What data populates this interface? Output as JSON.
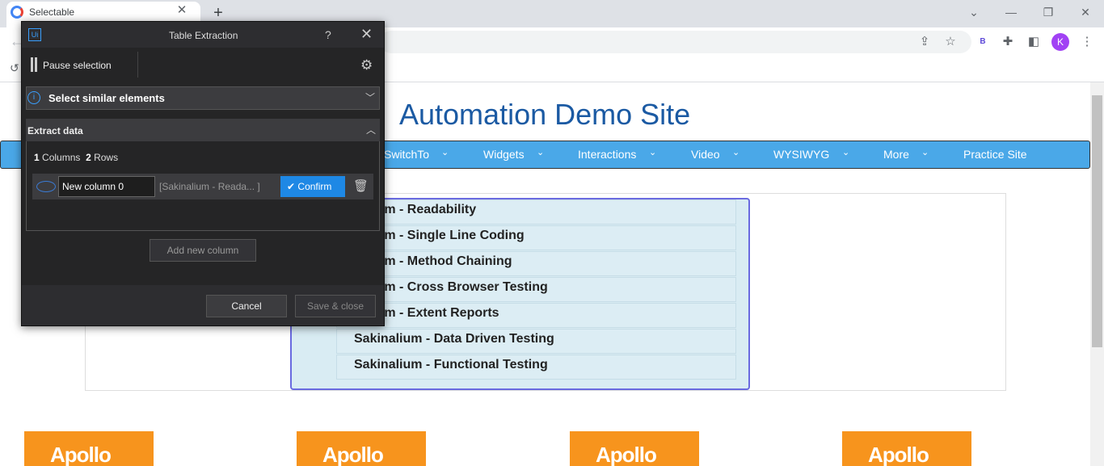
{
  "browser": {
    "tab_title": "Selectable",
    "tab_close": "✕",
    "new_tab": "+",
    "profile_initial": "K",
    "extension_label": "B",
    "window_controls": [
      "⌄",
      "—",
      "❐",
      "✕"
    ]
  },
  "page": {
    "site_title": "Automation Demo Site",
    "nav": [
      "SwitchTo",
      "Widgets",
      "Interactions",
      "Video",
      "WYSIWYG",
      "More",
      "Practice Site"
    ],
    "selectable_items": [
      "nalium - Readability",
      "nalium - Single Line Coding",
      "nalium - Method Chaining",
      "nalium - Cross Browser Testing",
      "nalium - Extent Reports",
      "Sakinalium - Data Driven Testing",
      "Sakinalium - Functional Testing"
    ],
    "banner_text": "Apollo"
  },
  "dialog": {
    "title": "Table Extraction",
    "help": "?",
    "pause_label": "Pause selection",
    "similar_label": "Select similar elements",
    "extract_label": "Extract data",
    "columns_count": "1",
    "columns_word": "Columns",
    "rows_count": "2",
    "rows_word": "Rows",
    "column_name": "New column 0",
    "column_preview": "[Sakinalium - Reada...  ]",
    "confirm_label": "Confirm",
    "add_column_label": "Add new column",
    "cancel_label": "Cancel",
    "save_label": "Save & close"
  },
  "colors": {
    "accent": "#1e88e5",
    "nav_bg": "#4aa8e8",
    "banner": "#f7941d",
    "site_title": "#1b5aa3"
  }
}
